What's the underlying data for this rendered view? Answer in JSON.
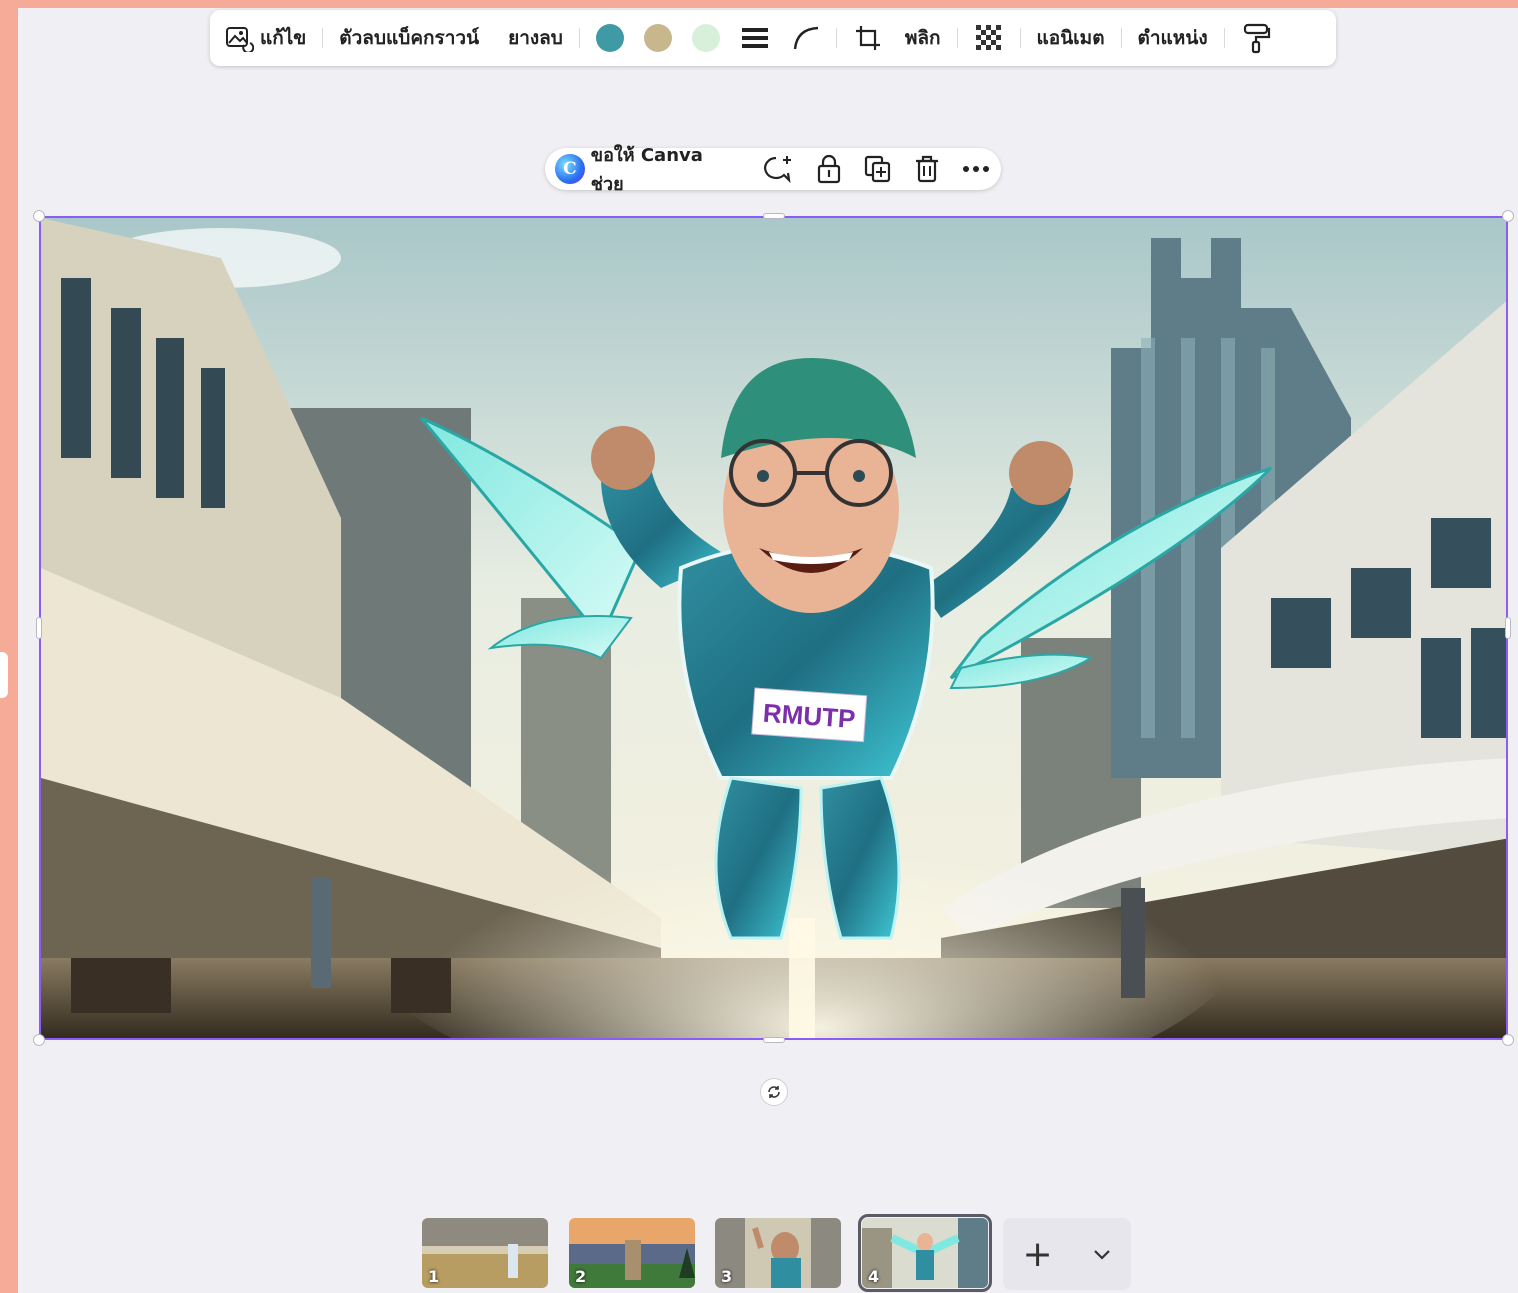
{
  "toolbar": {
    "edit_label": "แก้ไข",
    "bg_remover_label": "ตัวลบแบ็คกราวน์",
    "eraser_label": "ยางลบ",
    "colors": [
      "#3f9aa5",
      "#c8b78c",
      "#d7f0da"
    ],
    "flip_label": "พลิก",
    "animate_label": "แอนิเมต",
    "position_label": "ตำแหน่ง"
  },
  "context_menu": {
    "ask_canva_label": "ขอให้ Canva ช่วย"
  },
  "image": {
    "badge_text": "RMUTP"
  },
  "pages": [
    {
      "number": "1"
    },
    {
      "number": "2"
    },
    {
      "number": "3"
    },
    {
      "number": "4"
    }
  ],
  "add_page": {
    "plus_symbol": "+",
    "chevron_symbol": "⌄"
  }
}
